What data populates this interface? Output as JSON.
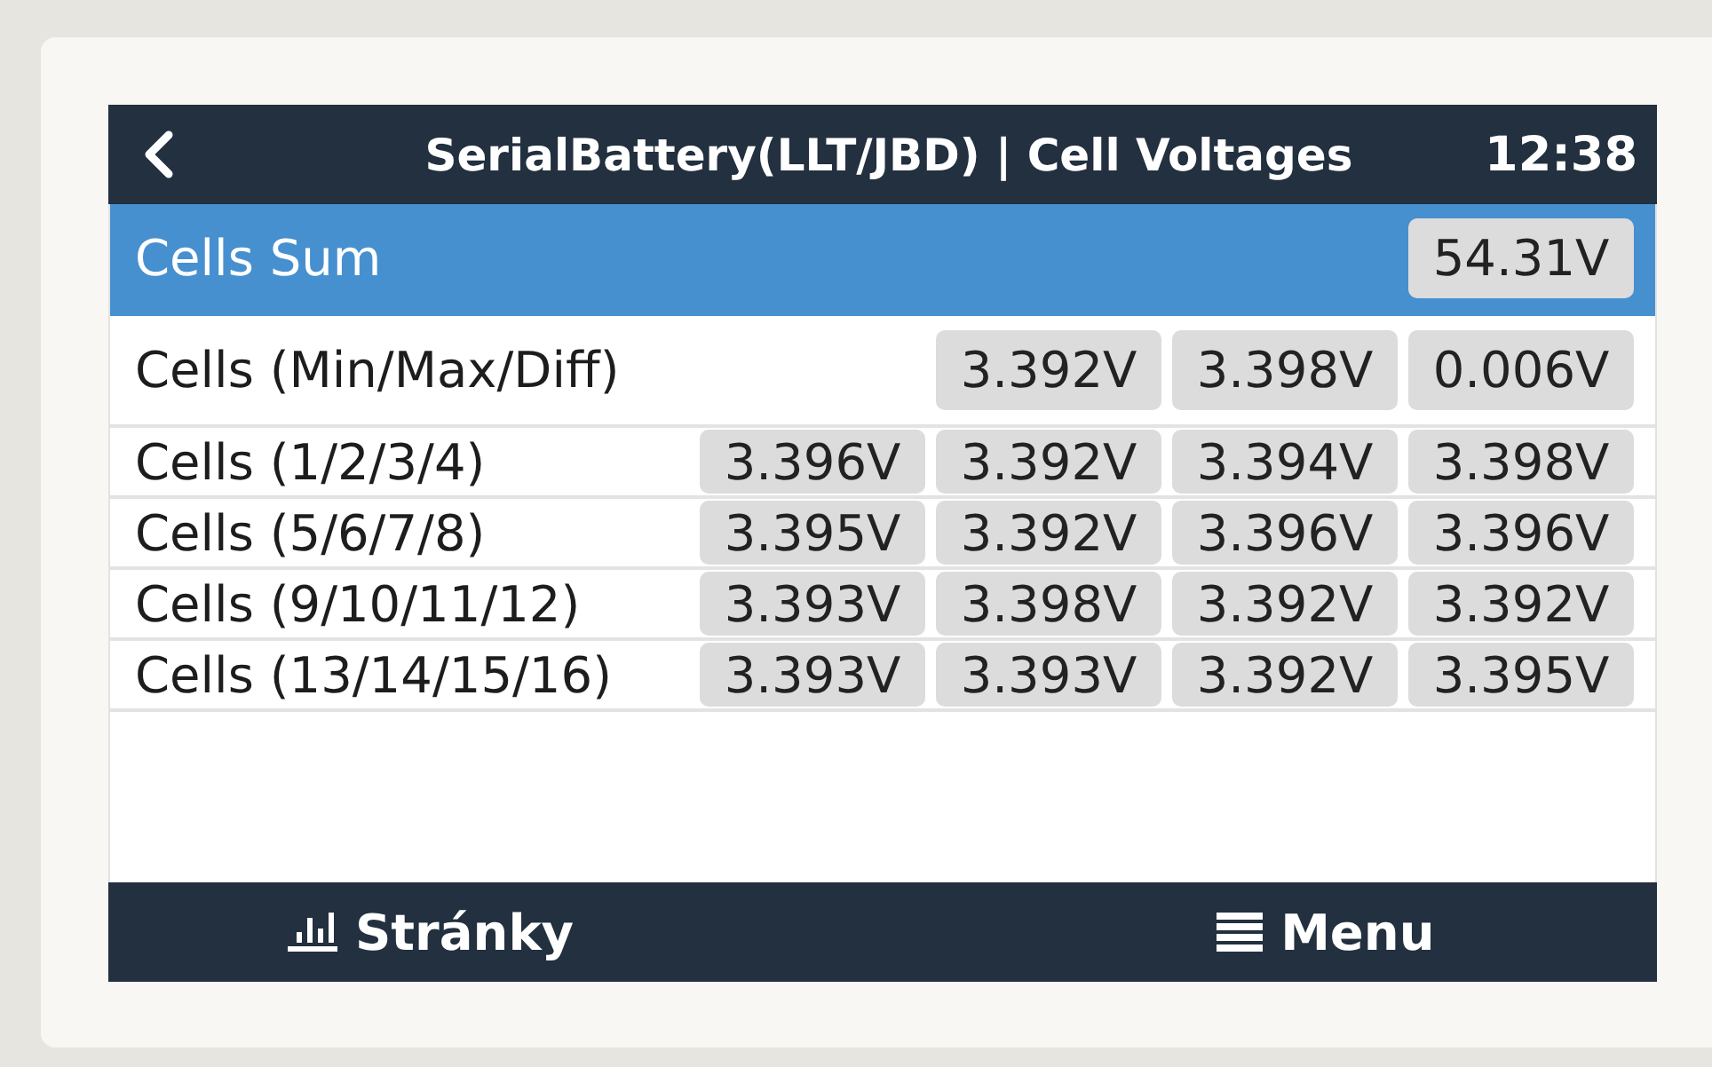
{
  "header": {
    "title": "SerialBattery(LLT/JBD) | Cell Voltages",
    "time": "12:38"
  },
  "rows": [
    {
      "label": "Cells Sum",
      "kind": "tall",
      "selected": true,
      "values": [
        "54.31V"
      ]
    },
    {
      "label": "Cells (Min/Max/Diff)",
      "kind": "tall",
      "selected": false,
      "values": [
        "3.392V",
        "3.398V",
        "0.006V"
      ]
    },
    {
      "label": "Cells (1/2/3/4)",
      "kind": "compact",
      "selected": false,
      "values": [
        "3.396V",
        "3.392V",
        "3.394V",
        "3.398V"
      ]
    },
    {
      "label": "Cells (5/6/7/8)",
      "kind": "compact",
      "selected": false,
      "values": [
        "3.395V",
        "3.392V",
        "3.396V",
        "3.396V"
      ]
    },
    {
      "label": "Cells (9/10/11/12)",
      "kind": "compact",
      "selected": false,
      "values": [
        "3.393V",
        "3.398V",
        "3.392V",
        "3.392V"
      ]
    },
    {
      "label": "Cells (13/14/15/16)",
      "kind": "compact",
      "selected": false,
      "values": [
        "3.393V",
        "3.393V",
        "3.392V",
        "3.395V"
      ]
    }
  ],
  "footer": {
    "buttons": [
      {
        "label": "Stránky",
        "kind": "pages"
      },
      {
        "label": "Menu",
        "kind": "menu"
      }
    ]
  }
}
